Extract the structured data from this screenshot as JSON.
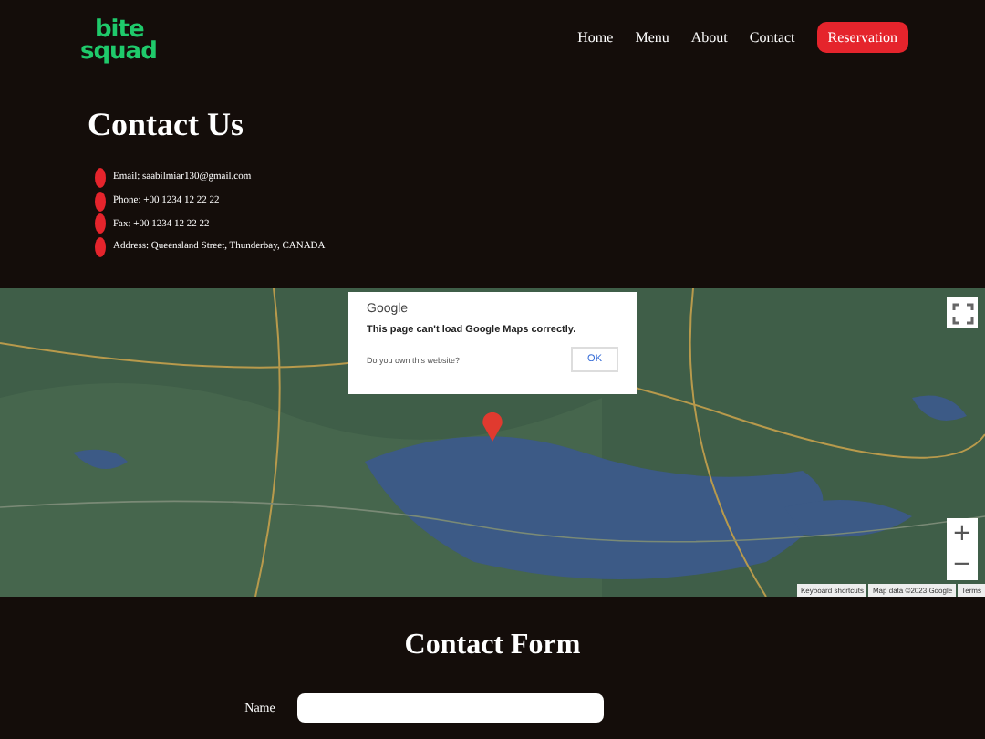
{
  "logo": {
    "line1": "bite",
    "line2": "squad"
  },
  "nav": [
    {
      "label": "Home",
      "kind": "link"
    },
    {
      "label": "Menu",
      "kind": "link"
    },
    {
      "label": "About",
      "kind": "link"
    },
    {
      "label": "Contact",
      "kind": "link"
    },
    {
      "label": "Reservation",
      "kind": "button"
    }
  ],
  "contact": {
    "title": "Contact Us",
    "items": [
      "Email: saabilmiar130@gmail.com",
      "Phone: +00 1234 12 22 22",
      "Fax: +00 1234 12 22 22",
      "Address: Queensland Street, Thunderbay, CANADA"
    ]
  },
  "map": {
    "dialog": {
      "title": "Google",
      "message": "This page can't load Google Maps correctly.",
      "question": "Do you own this website?",
      "button": "OK"
    },
    "zoom_in": "+",
    "zoom_out": "−",
    "attribution": [
      "Keyboard shortcuts",
      "Map data ©2023 Google",
      "Terms"
    ]
  },
  "form": {
    "title": "Contact Form",
    "fields": [
      {
        "label": "Name"
      }
    ]
  }
}
